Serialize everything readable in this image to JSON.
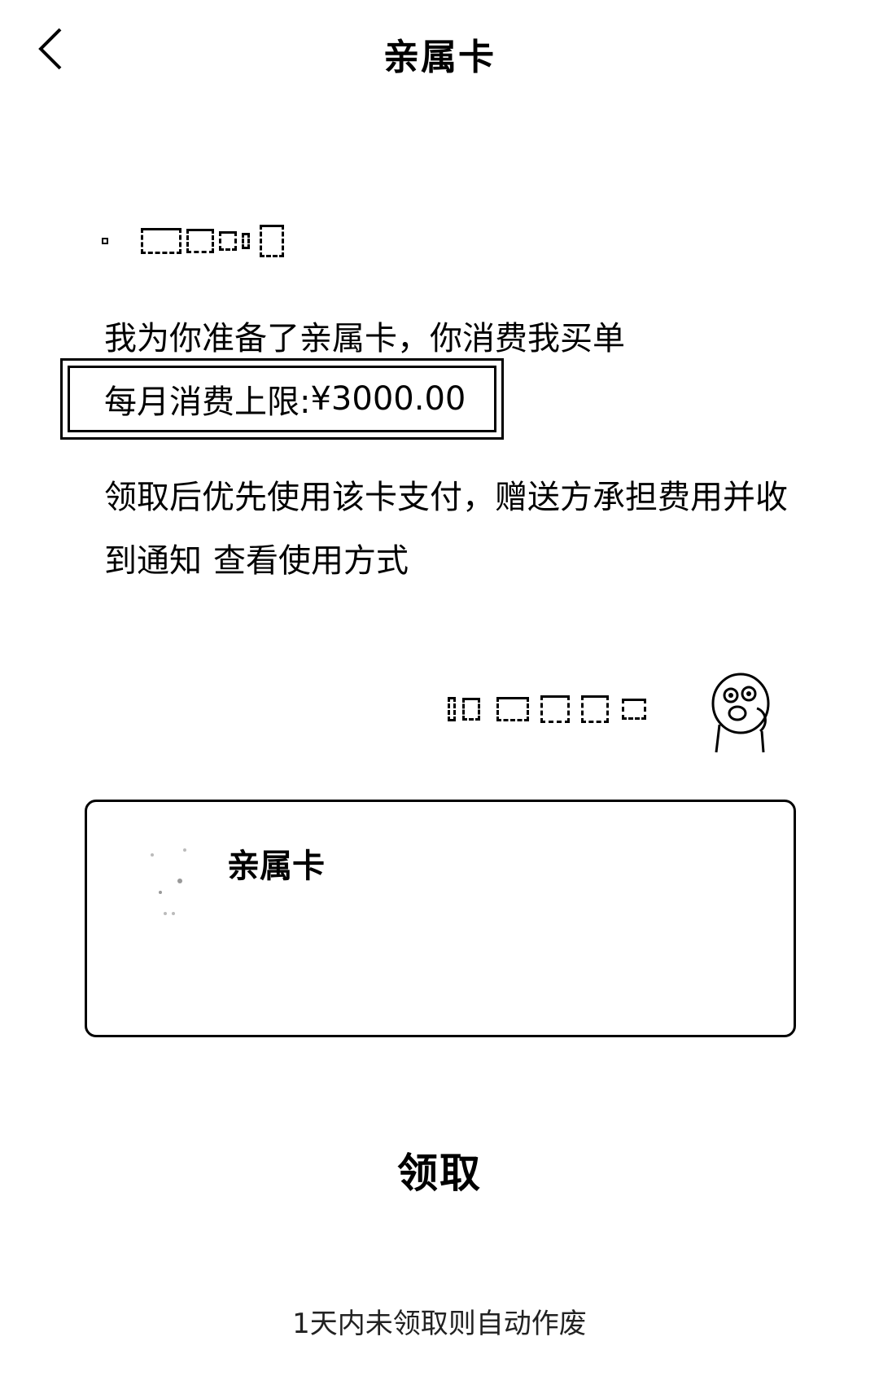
{
  "header": {
    "title": "亲属卡",
    "back_icon": "chevron-left-icon"
  },
  "message": {
    "line1": "我为你准备了亲属卡，你消费我买单",
    "limit_label": "每月消费上限: ",
    "limit_value": "¥3000.00",
    "description": "领取后优先使用该卡支付，赠送方承担费用并收到通知",
    "usage_link": "查看使用方式"
  },
  "card": {
    "title": "亲属卡"
  },
  "actions": {
    "claim_label": "领取",
    "expiry_note": "1天内未领取则自动作废"
  },
  "colors": {
    "text": "#000000",
    "background": "#ffffff"
  }
}
